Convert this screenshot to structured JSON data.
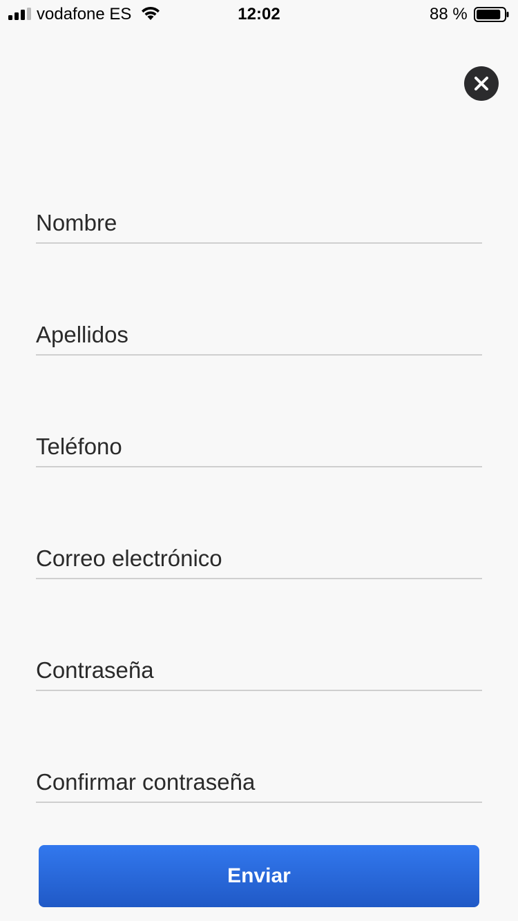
{
  "status_bar": {
    "carrier": "vodafone ES",
    "time": "12:02",
    "battery_percent": "88 %",
    "battery_level": 0.88,
    "signal_bars": 3
  },
  "form": {
    "fields": [
      {
        "placeholder": "Nombre",
        "value": ""
      },
      {
        "placeholder": "Apellidos",
        "value": ""
      },
      {
        "placeholder": "Teléfono",
        "value": ""
      },
      {
        "placeholder": "Correo electrónico",
        "value": ""
      },
      {
        "placeholder": "Contraseña",
        "value": ""
      },
      {
        "placeholder": "Confirmar contraseña",
        "value": ""
      }
    ],
    "submit_label": "Enviar"
  },
  "colors": {
    "background": "#f8f8f8",
    "accent": "#2a68dc",
    "close_button": "#2b2b2d"
  },
  "icons": {
    "close": "close-icon",
    "signal": "signal-icon",
    "wifi": "wifi-icon",
    "battery": "battery-icon"
  }
}
